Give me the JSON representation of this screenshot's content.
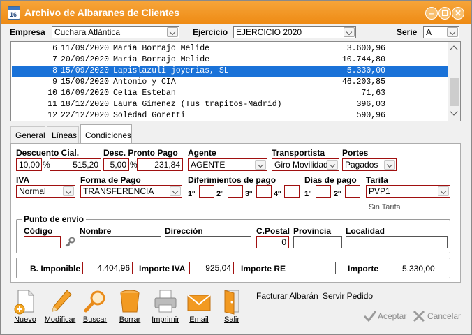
{
  "window": {
    "title": "Archivo de Albaranes de Clientes",
    "icon_label": "16"
  },
  "filters": {
    "empresa_label": "Empresa",
    "empresa_value": "Cuchara Atlántica",
    "ejercicio_label": "Ejercicio",
    "ejercicio_value": "EJERCICIO 2020",
    "serie_label": "Serie",
    "serie_value": "A"
  },
  "list": {
    "rows": [
      {
        "num": "6",
        "date": "11/09/2020",
        "client": "María Borrajo Melide",
        "amount": "3.600,96",
        "selected": false
      },
      {
        "num": "7",
        "date": "20/09/2020",
        "client": "María Borrajo Melide",
        "amount": "10.744,80",
        "selected": false
      },
      {
        "num": "8",
        "date": "15/09/2020",
        "client": "Lapislazuli joyerias, SL",
        "amount": "5.330,00",
        "selected": true
      },
      {
        "num": "9",
        "date": "15/09/2020",
        "client": "Antonio y CIA",
        "amount": "46.203,85",
        "selected": false
      },
      {
        "num": "10",
        "date": "16/09/2020",
        "client": "Celia Esteban",
        "amount": "71,63",
        "selected": false
      },
      {
        "num": "11",
        "date": "18/12/2020",
        "client": "Laura Gimenez (Tus trapitos-Madrid)",
        "amount": "396,03",
        "selected": false
      },
      {
        "num": "12",
        "date": "22/12/2020",
        "client": "Soledad Goretti",
        "amount": "590,96",
        "selected": false
      }
    ]
  },
  "tabs": [
    {
      "label": "General",
      "active": false
    },
    {
      "label": "Líneas",
      "active": false
    },
    {
      "label": "Condiciones",
      "active": true
    }
  ],
  "conditions": {
    "descuento_label": "Descuento Cial.",
    "descuento_pct": "10,00",
    "pct_sign": "%",
    "descuento_amount": "515,20",
    "pronto_label": "Desc. Pronto Pago",
    "pronto_pct": "5,00",
    "pronto_amount": "231,84",
    "agente_label": "Agente",
    "agente_value": "AGENTE",
    "transportista_label": "Transportista",
    "transportista_value": "Giro Movilidad",
    "portes_label": "Portes",
    "portes_value": "Pagados",
    "iva_label": "IVA",
    "iva_value": "Normal",
    "forma_label": "Forma de Pago",
    "forma_value": "TRANSFERENCIA",
    "diferimientos_label": "Diferimientos de pago",
    "dif_labels": [
      "1º",
      "2º",
      "3º",
      "4º"
    ],
    "dias_label": "Días de pago",
    "dias_labels": [
      "1º",
      "2º"
    ],
    "tarifa_label": "Tarifa",
    "tarifa_value": "PVP1",
    "tarifa_note": "Sin Tarifa"
  },
  "envio": {
    "group_label": "Punto de envío",
    "codigo_label": "Código",
    "nombre_label": "Nombre",
    "direccion_label": "Dirección",
    "cpostal_label": "C.Postal",
    "cpostal_value": "0",
    "provincia_label": "Provincia",
    "localidad_label": "Localidad"
  },
  "totals": {
    "imponible_label": "B. Imponible",
    "imponible_value": "4.404,96",
    "iva_label": "Importe IVA",
    "iva_value": "925,04",
    "re_label": "Importe RE",
    "re_value": "",
    "importe_label": "Importe",
    "importe_value": "5.330,00"
  },
  "toolbar": {
    "nuevo": "Nuevo",
    "modificar": "Modificar",
    "buscar": "Buscar",
    "borrar": "Borrar",
    "imprimir": "Imprimir",
    "email": "Email",
    "salir": "Salir",
    "facturar": "Facturar Albarán",
    "servir": "Servir Pedido",
    "aceptar": "Aceptar",
    "cancelar": "Cancelar"
  },
  "colors": {
    "title_bar": "#f29a22",
    "selection": "#1a72d8",
    "required_border": "#a01010"
  }
}
